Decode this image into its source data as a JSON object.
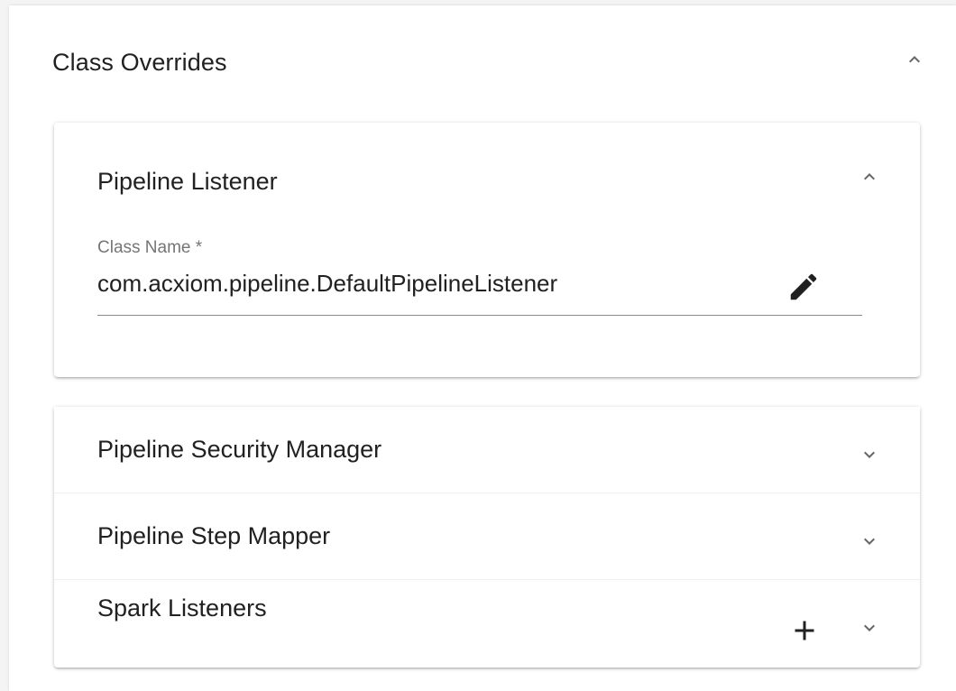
{
  "class_overrides": {
    "title": "Class Overrides",
    "expanded": true
  },
  "panels": [
    {
      "title": "Pipeline Listener",
      "expanded": true,
      "field": {
        "label": "Class Name *",
        "value": "com.acxiom.pipeline.DefaultPipelineListener"
      }
    },
    {
      "title": "Pipeline Security Manager",
      "expanded": false
    },
    {
      "title": "Pipeline Step Mapper",
      "expanded": false
    },
    {
      "title": "Spark Listeners",
      "expanded": false,
      "has_add": true
    }
  ],
  "icons": {
    "collapse": "chevron-up-icon",
    "expand": "chevron-down-icon",
    "edit": "pencil-icon",
    "add": "plus-icon"
  },
  "colors": {
    "text": "#212121",
    "label": "#757575",
    "icon": "#666666"
  }
}
